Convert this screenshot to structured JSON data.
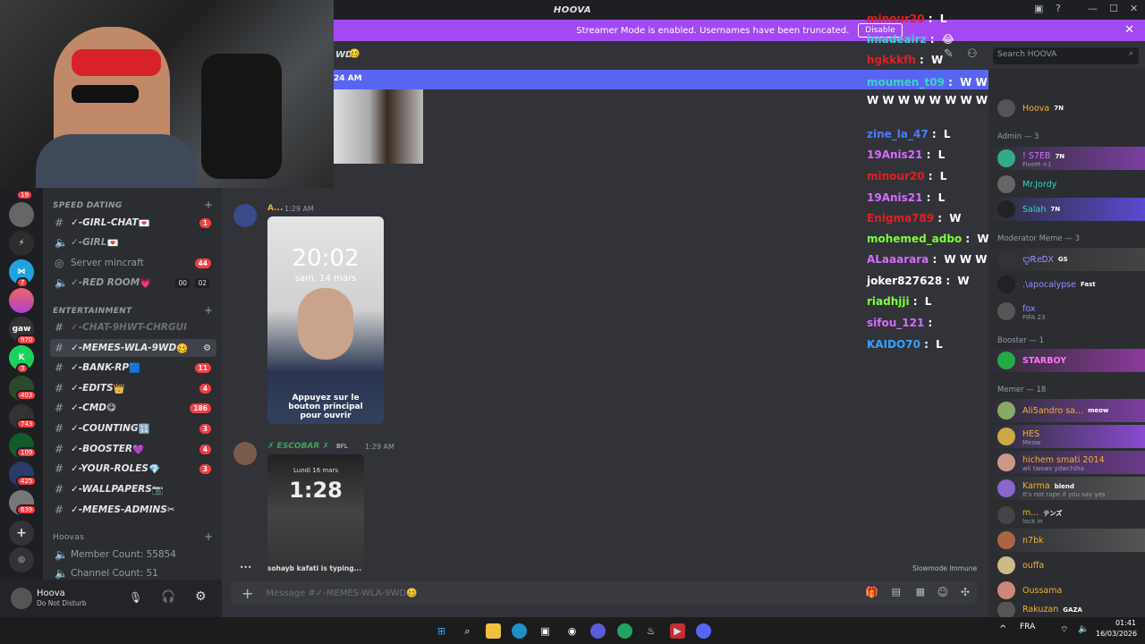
{
  "window": {
    "title": "HOOVA"
  },
  "streamer": {
    "text": "Streamer Mode is enabled. Usernames have been truncated.",
    "disable_label": "Disable"
  },
  "header": {
    "channel_fragment": "WD",
    "time": "24 AM",
    "search_placeholder": "Search HOOVA"
  },
  "rail_badges": [
    "19",
    "",
    "7",
    "970",
    "3",
    "403",
    "743",
    "109",
    "425",
    "639"
  ],
  "categories": {
    "speed_dating": "SPEED DATING",
    "entertainment": "ENTERTAINMENT",
    "hoovas": "Hoovas"
  },
  "channels": [
    {
      "name": "✓-GIRL-CHAT",
      "emoji": "💌",
      "badge": "1",
      "type": "text"
    },
    {
      "name": "✓-GIRL",
      "emoji": "💌",
      "badge": "",
      "type": "voice"
    },
    {
      "name": "Server mincraft",
      "emoji": "",
      "badge": "44",
      "type": "stage"
    },
    {
      "name": "✓-RED ROOM",
      "emoji": "💗",
      "badge": "",
      "type": "voice",
      "counts": [
        "00",
        "02"
      ]
    }
  ],
  "ent_channels": [
    {
      "name": "✓-CHAT-9HWT-CHRGUI",
      "emoji": "",
      "badge": "",
      "muted": true
    },
    {
      "name": "✓-MEMES-WLA-9WD",
      "emoji": "🥴",
      "badge": "",
      "selected": true
    },
    {
      "name": "✓-BANK-RP",
      "emoji": "🟦",
      "badge": "11"
    },
    {
      "name": "✓-EDITS",
      "emoji": "👑",
      "badge": "4"
    },
    {
      "name": "✓-CMD",
      "emoji": "😋",
      "badge": "186"
    },
    {
      "name": "✓-COUNTING",
      "emoji": "🔢",
      "badge": "3"
    },
    {
      "name": "✓-BOOSTER",
      "emoji": "💜",
      "badge": "4"
    },
    {
      "name": "✓-YOUR-ROLES",
      "emoji": "💎",
      "badge": "3"
    },
    {
      "name": "✓-WALLPAPERS",
      "emoji": "📷",
      "badge": ""
    },
    {
      "name": "✓-MEMES-ADMINS",
      "emoji": "✂",
      "badge": ""
    }
  ],
  "hoovas": {
    "member_count": "Member Count: 55854",
    "channel_count": "Channel Count: 51"
  },
  "user": {
    "name": "Hoova",
    "status": "Do Not Disturb"
  },
  "messages": [
    {
      "author": "A...",
      "time": "1:29 AM",
      "phone_clock": "20:02",
      "phone_date": "sam. 14 mars",
      "phone_hint": "Appuyez sur le bouton principal pour ouvrir"
    },
    {
      "author": "✗ ESCOBAR ✗",
      "tag": "BFL",
      "time": "1:29 AM",
      "phone_clock": "1:28",
      "phone_date": "Lundi 16 mars"
    }
  ],
  "typing": "sohayb kafati is typing...",
  "slowmode": "Slowmode Immune",
  "composer_placeholder": "Message #✓-MEMES-WLA-9WD🥴",
  "overlay_chat": [
    {
      "user": "minour20",
      "msg": "L",
      "color": "#e02020"
    },
    {
      "user": "imadeairz",
      "msg": "😂",
      "color": "#3ad4c4"
    },
    {
      "user": "hgkkkfh",
      "msg": "W",
      "color": "#e02020"
    },
    {
      "user": "moumen_t09",
      "msg": "W W W W W W W W W W W W W W W W W W W W W W",
      "color": "#3ad4c4"
    },
    {
      "user": "zine_la_47",
      "msg": "L",
      "color": "#4b7bff"
    },
    {
      "user": "19Anis21",
      "msg": "L",
      "color": "#d56cff"
    },
    {
      "user": "minour20",
      "msg": "L",
      "color": "#e02020"
    },
    {
      "user": "19Anis21",
      "msg": "L",
      "color": "#d56cff"
    },
    {
      "user": "Enigma789",
      "msg": "W",
      "color": "#e02020"
    },
    {
      "user": "mohemed_adbo",
      "msg": "W",
      "color": "#7dff3a"
    },
    {
      "user": "ALaaarara",
      "msg": "W W W W",
      "color": "#d56cff"
    },
    {
      "user": "joker827628",
      "msg": "W",
      "color": "#ffffff"
    },
    {
      "user": "riadhjji",
      "msg": "L",
      "color": "#7dff3a"
    },
    {
      "user": "sifou_121",
      "msg": "",
      "color": "#d56cff"
    },
    {
      "user": "KAIDO70",
      "msg": "L",
      "color": "#3aa0ff"
    }
  ],
  "members": {
    "owner": {
      "name": "Hoova",
      "tag": "7N"
    },
    "admin_title": "Admin — 3",
    "admins": [
      {
        "name": "! S7EB",
        "tag": "7N",
        "sub": "FiveM +1"
      },
      {
        "name": "Mr.Jordy",
        "tag": "",
        "sub": ""
      },
      {
        "name": "Salah",
        "tag": "7N",
        "sub": ""
      }
    ],
    "mod_title": "Moderator Meme — 3",
    "mods": [
      {
        "name": "ꨄᎡeᎠX",
        "tag": "GS",
        "sub": ""
      },
      {
        "name": ".\\apocalypse",
        "tag": "Fast",
        "sub": ""
      },
      {
        "name": "fox",
        "tag": "",
        "sub": "FIFA 23"
      }
    ],
    "booster_title": "Booster — 1",
    "boosters": [
      {
        "name": "STARBOY",
        "tag": "",
        "sub": ""
      }
    ],
    "memer_title": "Memer — 18",
    "memers": [
      {
        "name": "Ali5andro sa...",
        "tag": "meow",
        "sub": ""
      },
      {
        "name": "HES",
        "tag": "",
        "sub": "Meow"
      },
      {
        "name": "hichem smati 2014",
        "tag": "",
        "sub": "wli twsws ydwchlha"
      },
      {
        "name": "Karma",
        "tag": "blend",
        "sub": "It's not rape if you say yes"
      },
      {
        "name": "m...",
        "tag": "テンズ",
        "sub": "lock in"
      },
      {
        "name": "n7bk",
        "tag": "",
        "sub": ""
      },
      {
        "name": "ouffa",
        "tag": "",
        "sub": ""
      },
      {
        "name": "Oussama",
        "tag": "",
        "sub": ""
      },
      {
        "name": "Rakuzan",
        "tag": "GAZA",
        "sub": ""
      }
    ]
  },
  "taskbar": {
    "lang": "FRA",
    "time": "01:41",
    "date": "16/03/2026"
  }
}
